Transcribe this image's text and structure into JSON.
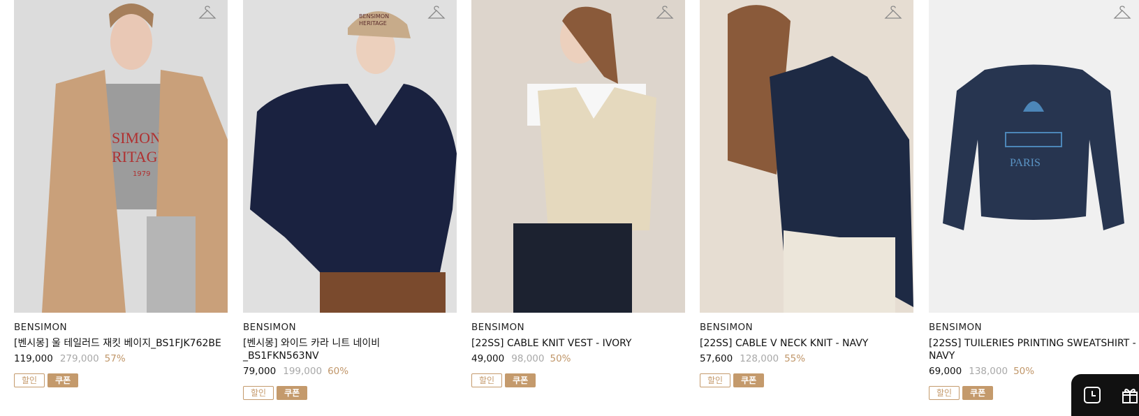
{
  "products": [
    {
      "brand": "BENSIMON",
      "name": "[벤시몽] 울 테일러드 재킷 베이지_BS1FJK762BE",
      "price": "119,000",
      "original_price": "279,000",
      "discount": "57%",
      "tags": {
        "sale": "할인",
        "coupon": "쿠폰"
      },
      "print_text": {
        "line1": "SIMON",
        "line2": "RITAGE",
        "line3": "1979"
      }
    },
    {
      "brand": "BENSIMON",
      "name": "[벤시몽] 와이드 카라 니트 네이비_BS1FKN563NV",
      "price": "79,000",
      "original_price": "199,000",
      "discount": "60%",
      "tags": {
        "sale": "할인",
        "coupon": "쿠폰"
      },
      "print_text": {
        "cap1": "BENSIMON",
        "cap2": "HERITAGE"
      }
    },
    {
      "brand": "BENSIMON",
      "name": "[22SS] CABLE KNIT VEST - IVORY",
      "price": "49,000",
      "original_price": "98,000",
      "discount": "50%",
      "tags": {
        "sale": "할인",
        "coupon": "쿠폰"
      }
    },
    {
      "brand": "BENSIMON",
      "name": "[22SS] CABLE V NECK KNIT - NAVY",
      "price": "57,600",
      "original_price": "128,000",
      "discount": "55%",
      "tags": {
        "sale": "할인",
        "coupon": "쿠폰"
      }
    },
    {
      "brand": "BENSIMON",
      "name": "[22SS] TUILERIES PRINTING SWEATSHIRT - NAVY",
      "price": "69,000",
      "original_price": "138,000",
      "discount": "50%",
      "tags": {
        "sale": "할인",
        "coupon": "쿠폰"
      },
      "print_text": {
        "paris": "PARIS"
      }
    }
  ],
  "icons": {
    "wishlist": "hanger-icon",
    "recent": "clock-icon",
    "gift": "gift-icon"
  },
  "colors": {
    "accent": "#c49a6c",
    "discount_text": "#c09669",
    "original_price": "#a8a8a8",
    "dock": "#111111"
  }
}
